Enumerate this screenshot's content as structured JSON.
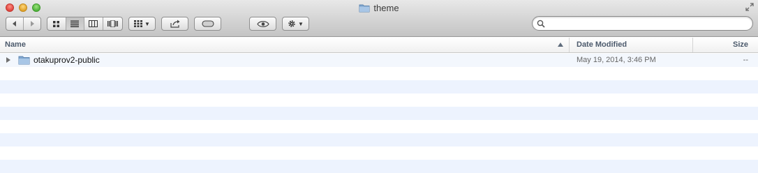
{
  "window": {
    "title": "theme",
    "folder_icon": "folder-icon"
  },
  "toolbar": {
    "back_icon": "chevron-left-icon",
    "forward_icon": "chevron-right-icon",
    "view_icons": [
      "icon-view-icon",
      "list-view-icon",
      "column-view-icon",
      "cover-flow-icon"
    ],
    "active_view": "list-view-icon",
    "arrange_icon": "arrange-grid-icon",
    "share_icon": "share-icon",
    "tags_icon": "tag-pill-icon",
    "quicklook_icon": "eye-icon",
    "action_icon": "gear-icon"
  },
  "search": {
    "value": "",
    "placeholder": ""
  },
  "columns": {
    "name": "Name",
    "date": "Date Modified",
    "size": "Size"
  },
  "files": [
    {
      "name": "otakuprov2-public",
      "date_modified": "May 19, 2014, 3:46 PM",
      "size": "--",
      "kind": "folder"
    }
  ],
  "colors": {
    "stripe": "#edf3fe",
    "header_text": "#4c5a6c",
    "folder": "#7fa6cf"
  }
}
